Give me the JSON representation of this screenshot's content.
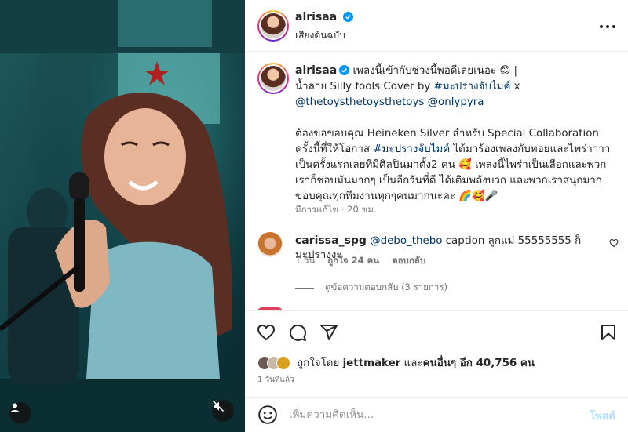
{
  "post": {
    "username": "alrisaa",
    "audio_label": "เสียงต้นฉบับ",
    "caption": {
      "line1": "เพลงนี้เข้ากับช่วงนี้พอดีเลยเนอะ 😊 |",
      "line2_prefix": "น้ำลาย Silly fools Cover by ",
      "hashtag1": "#มะปรางจับไมค์",
      "line2_suffix": " x",
      "mention1": "@thetoysthetoysthetoys",
      "mention2": "@onlypyra",
      "para2_a": "ต้องขอขอบคุณ Heineken Silver สำหรับ Special Collaboration ครั้งนี้ที่ให้โอกาส ",
      "hashtag2": "#มะปรางจับไมค์",
      "para2_b": " ได้มาร้องเพลงกับทอยและไพร่าาาา เป็นครั้งแรกเลยที่มีศิลปินมาตั้ง2 คน 🥰 เพลงนี้ไพร่าเป็นเลือกและพวกเราก็ชอบมันมากๆ เป็นอีกวันที่ดี ได้เติมพลังบวก และพวกเราสนุกมาก ขอบคุณทุกทีมงานทุกๆคนมากนะคะ 🌈🥰🎤"
    },
    "caption_meta": "มีการแก้ไข · 20 ชม."
  },
  "comments": [
    {
      "username": "carissa_spg",
      "mention": "@debo_thebo",
      "text": " caption ลูกแม่ 55555555 ก็มะปรางงะ",
      "time": "1 วัน",
      "likes": "ถูกใจ 24 คน",
      "reply_label": "ตอบกลับ",
      "view_replies": "ดูข้อความตอบกลับ (3 รายการ)"
    }
  ],
  "likes": {
    "prefix": "ถูกใจโดย ",
    "first_user": "jettmaker",
    "middle": " และ",
    "others": "คนอื่นๆ อีก 40,756 คน"
  },
  "date": "1 วันที่แล้ว",
  "composer": {
    "placeholder": "เพิ่มความคิดเห็น...",
    "post_label": "โพสต์"
  },
  "colors": {
    "link": "#00376b",
    "verified": "#0095f6",
    "post_disabled": "#b3dbff",
    "muted_text": "#737373"
  }
}
